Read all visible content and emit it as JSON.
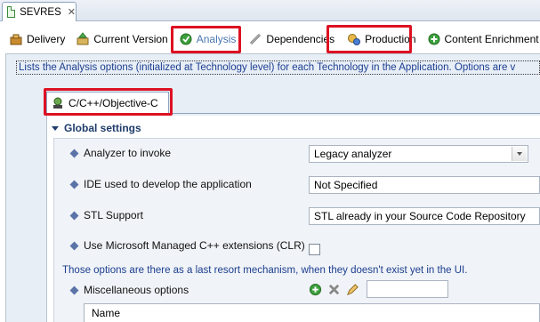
{
  "editor": {
    "tab_label": "SEVRES"
  },
  "page_tabs": [
    {
      "label": "Delivery",
      "icon": "delivery-icon"
    },
    {
      "label": "Current Version",
      "icon": "version-icon"
    },
    {
      "label": "Analysis",
      "icon": "analysis-icon",
      "selected": true
    },
    {
      "label": "Dependencies",
      "icon": "dependencies-icon"
    },
    {
      "label": "Production",
      "icon": "production-icon"
    },
    {
      "label": "Content Enrichment",
      "icon": "enrichment-icon"
    }
  ],
  "description": "Lists the Analysis options (initialized at Technology level) for each Technology in the Application. Options are v",
  "technology_tab": {
    "label": "C/C++/Objective-C"
  },
  "global_settings": {
    "title": "Global settings",
    "analyzer": {
      "label": "Analyzer to invoke",
      "value": "Legacy analyzer"
    },
    "ide": {
      "label": "IDE used to develop the application",
      "value": "Not Specified"
    },
    "stl": {
      "label": "STL Support",
      "value": "STL already in your Source Code Repository"
    },
    "clr": {
      "label": "Use Microsoft Managed C++ extensions (CLR)",
      "checked": false
    },
    "note": "Those options are there as a last resort mechanism, when they doesn't exist yet in the UI.",
    "misc": {
      "label": "Miscellaneous options",
      "table_header": "Name"
    }
  },
  "colors": {
    "highlight": "#dd1122",
    "accent_text": "#1b3e8f",
    "selected_tab_text": "#4a76b3"
  }
}
